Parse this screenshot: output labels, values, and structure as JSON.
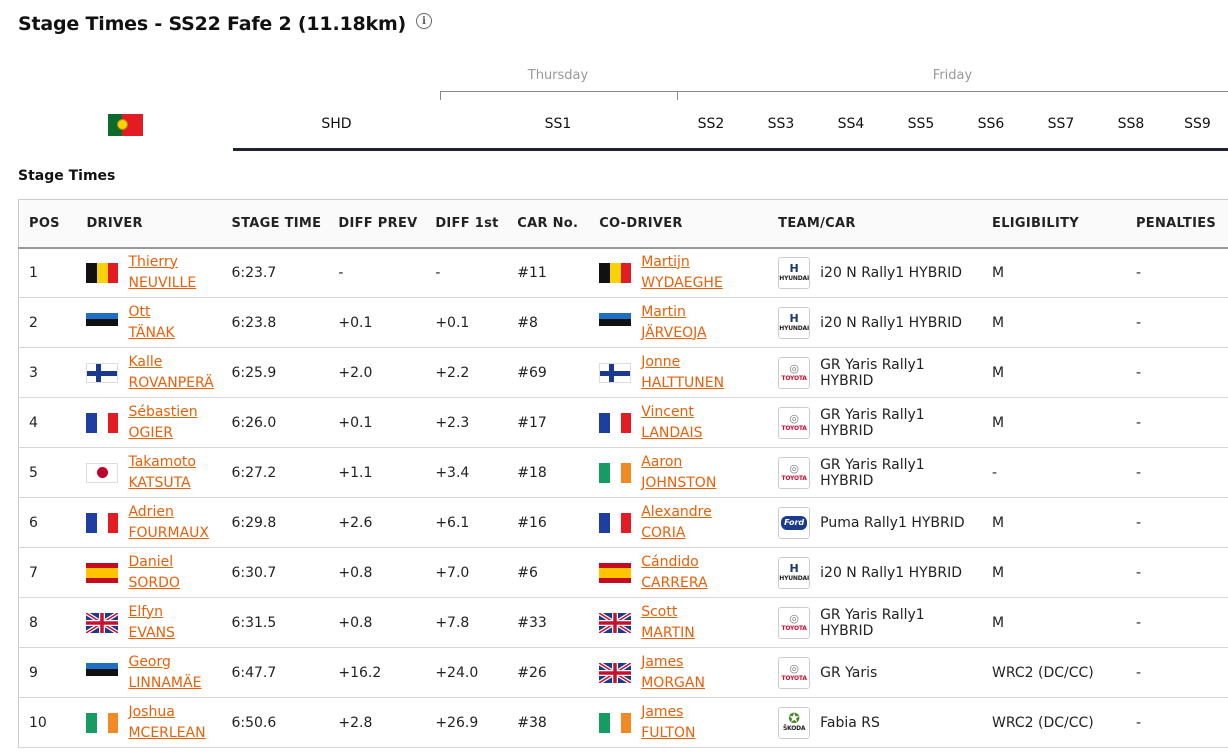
{
  "title": "Stage Times - SS22 Fafe 2 (11.18km)",
  "info_icon": "i",
  "days": [
    {
      "label": "Thursday"
    },
    {
      "label": "Friday"
    }
  ],
  "country_flag": "portugal-flag",
  "stage_tabs": [
    "SHD",
    "SS1",
    "SS2",
    "SS3",
    "SS4",
    "SS5",
    "SS6",
    "SS7",
    "SS8",
    "SS9"
  ],
  "section_label": "Stage Times",
  "columns": [
    "POS",
    "DRIVER",
    "STAGE TIME",
    "DIFF PREV",
    "DIFF 1st",
    "CAR No.",
    "CO-DRIVER",
    "TEAM/CAR",
    "ELIGIBILITY",
    "PENALTIES"
  ],
  "brands": {
    "hyundai": {
      "emblem": "H",
      "text": "HYUNDAI"
    },
    "toyota": {
      "emblem": "◎",
      "text": "TOYOTA"
    },
    "ford": {
      "emblem": "Ford",
      "text": ""
    },
    "skoda": {
      "emblem": "✪",
      "text": "ŠKODA"
    }
  },
  "rows": [
    {
      "pos": "1",
      "driver_first": "Thierry",
      "driver_last": "NEUVILLE",
      "driver_flag": "belgium",
      "time": "6:23.7",
      "diff_prev": "-",
      "diff_first": "-",
      "car_no": "#11",
      "co_first": "Martijn",
      "co_last": "WYDAEGHE",
      "co_flag": "belgium",
      "brand": "hyundai",
      "car": "i20 N Rally1 HYBRID",
      "eligibility": "M",
      "penalties": "-"
    },
    {
      "pos": "2",
      "driver_first": "Ott",
      "driver_last": "TÄNAK",
      "driver_flag": "estonia",
      "time": "6:23.8",
      "diff_prev": "+0.1",
      "diff_first": "+0.1",
      "car_no": "#8",
      "co_first": "Martin",
      "co_last": "JÄRVEOJA",
      "co_flag": "estonia",
      "brand": "hyundai",
      "car": "i20 N Rally1 HYBRID",
      "eligibility": "M",
      "penalties": "-"
    },
    {
      "pos": "3",
      "driver_first": "Kalle",
      "driver_last": "ROVANPERÄ",
      "driver_flag": "finland",
      "time": "6:25.9",
      "diff_prev": "+2.0",
      "diff_first": "+2.2",
      "car_no": "#69",
      "co_first": "Jonne",
      "co_last": "HALTTUNEN",
      "co_flag": "finland",
      "brand": "toyota",
      "car": "GR Yaris Rally1 HYBRID",
      "eligibility": "M",
      "penalties": "-"
    },
    {
      "pos": "4",
      "driver_first": "Sébastien",
      "driver_last": "OGIER",
      "driver_flag": "france",
      "time": "6:26.0",
      "diff_prev": "+0.1",
      "diff_first": "+2.3",
      "car_no": "#17",
      "co_first": "Vincent",
      "co_last": "LANDAIS",
      "co_flag": "france",
      "brand": "toyota",
      "car": "GR Yaris Rally1 HYBRID",
      "eligibility": "M",
      "penalties": "-"
    },
    {
      "pos": "5",
      "driver_first": "Takamoto",
      "driver_last": "KATSUTA",
      "driver_flag": "japan",
      "time": "6:27.2",
      "diff_prev": "+1.1",
      "diff_first": "+3.4",
      "car_no": "#18",
      "co_first": "Aaron",
      "co_last": "JOHNSTON",
      "co_flag": "ireland",
      "brand": "toyota",
      "car": "GR Yaris Rally1 HYBRID",
      "eligibility": "-",
      "penalties": "-"
    },
    {
      "pos": "6",
      "driver_first": "Adrien",
      "driver_last": "FOURMAUX",
      "driver_flag": "france",
      "time": "6:29.8",
      "diff_prev": "+2.6",
      "diff_first": "+6.1",
      "car_no": "#16",
      "co_first": "Alexandre",
      "co_last": "CORIA",
      "co_flag": "france",
      "brand": "ford",
      "car": "Puma Rally1 HYBRID",
      "eligibility": "M",
      "penalties": "-"
    },
    {
      "pos": "7",
      "driver_first": "Daniel",
      "driver_last": "SORDO",
      "driver_flag": "spain",
      "time": "6:30.7",
      "diff_prev": "+0.8",
      "diff_first": "+7.0",
      "car_no": "#6",
      "co_first": "Cándido",
      "co_last": "CARRERA",
      "co_flag": "spain",
      "brand": "hyundai",
      "car": "i20 N Rally1 HYBRID",
      "eligibility": "M",
      "penalties": "-"
    },
    {
      "pos": "8",
      "driver_first": "Elfyn",
      "driver_last": "EVANS",
      "driver_flag": "uk",
      "time": "6:31.5",
      "diff_prev": "+0.8",
      "diff_first": "+7.8",
      "car_no": "#33",
      "co_first": "Scott",
      "co_last": "MARTIN",
      "co_flag": "uk",
      "brand": "toyota",
      "car": "GR Yaris Rally1 HYBRID",
      "eligibility": "M",
      "penalties": "-"
    },
    {
      "pos": "9",
      "driver_first": "Georg",
      "driver_last": "LINNAMÄE",
      "driver_flag": "estonia",
      "time": "6:47.7",
      "diff_prev": "+16.2",
      "diff_first": "+24.0",
      "car_no": "#26",
      "co_first": "James",
      "co_last": "MORGAN",
      "co_flag": "uk",
      "brand": "toyota",
      "car": "GR Yaris",
      "eligibility": "WRC2 (DC/CC)",
      "penalties": "-"
    },
    {
      "pos": "10",
      "driver_first": "Joshua",
      "driver_last": "MCERLEAN",
      "driver_flag": "ireland",
      "time": "6:50.6",
      "diff_prev": "+2.8",
      "diff_first": "+26.9",
      "car_no": "#38",
      "co_first": "James",
      "co_last": "FULTON",
      "co_flag": "ireland",
      "brand": "skoda",
      "car": "Fabia RS",
      "eligibility": "WRC2 (DC/CC)",
      "penalties": "-"
    }
  ]
}
